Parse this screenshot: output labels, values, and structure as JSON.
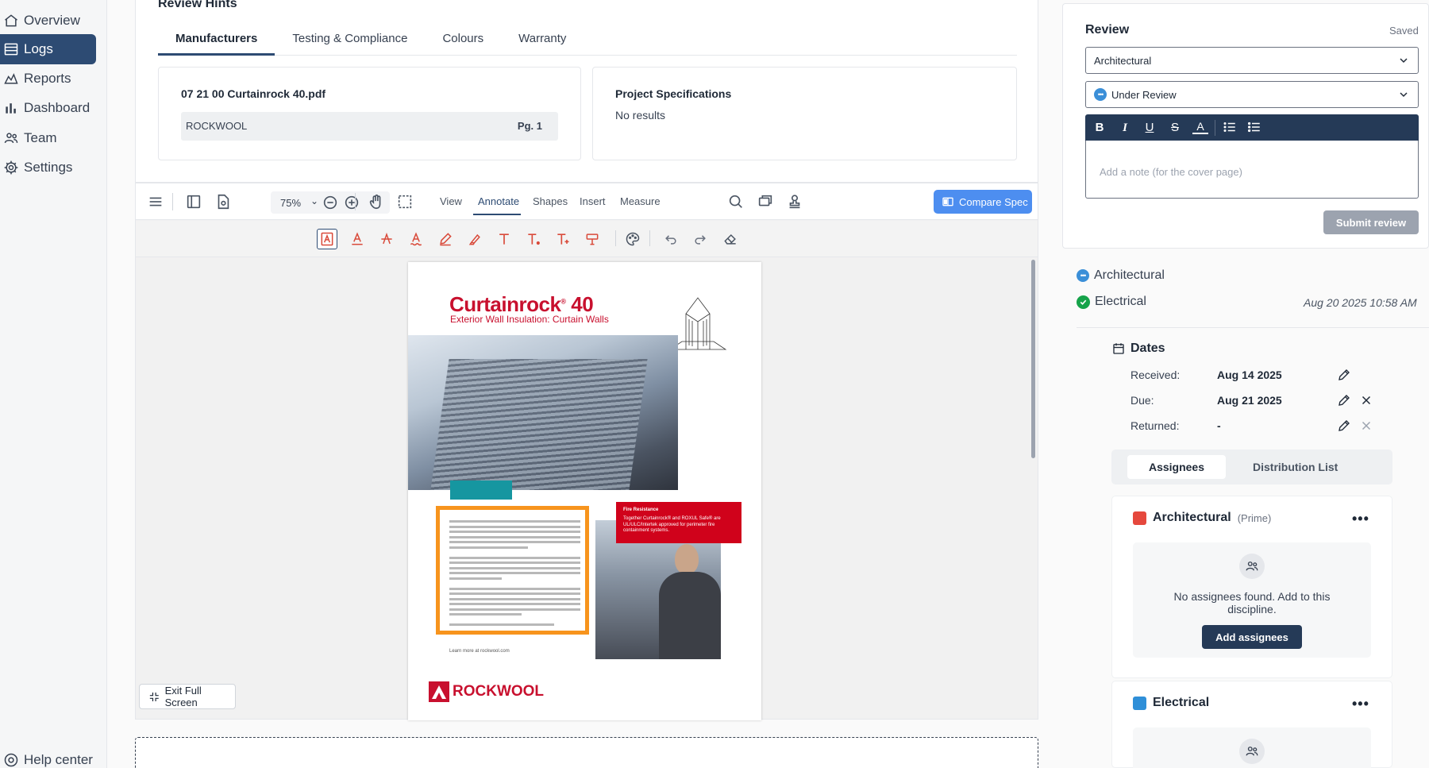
{
  "sidebar": {
    "items": [
      {
        "label": "Overview",
        "icon": "home-icon"
      },
      {
        "label": "Logs",
        "icon": "list-icon"
      },
      {
        "label": "Reports",
        "icon": "chart-area-icon"
      },
      {
        "label": "Dashboard",
        "icon": "bar-chart-icon"
      },
      {
        "label": "Team",
        "icon": "team-icon"
      },
      {
        "label": "Settings",
        "icon": "gear-icon"
      }
    ],
    "help": "Help center"
  },
  "hints": {
    "title": "Review Hints",
    "tabs": [
      "Manufacturers",
      "Testing & Compliance",
      "Colours",
      "Warranty"
    ],
    "file": {
      "name": "07 21 00 Curtainrock 40.pdf",
      "manufacturer": "ROCKWOOL",
      "page": "Pg. 1"
    },
    "specs": {
      "title": "Project Specifications",
      "result": "No results"
    }
  },
  "viewer": {
    "zoom": "75%",
    "tabs": [
      "View",
      "Annotate",
      "Shapes",
      "Insert",
      "Measure"
    ],
    "active_tab": "Annotate",
    "compare_label": "Compare Spec",
    "exit_label": "Exit Full Screen",
    "accent": "#4d8ef0"
  },
  "pdf": {
    "title": "Curtainrock",
    "reg": "®",
    "title_num": " 40",
    "subtitle": "Exterior Wall Insulation: Curtain Walls",
    "red_box_title": "Fire Resistance",
    "red_box_text": "Together Curtainrock® and ROXUL Safe® are UL/ULC/Intertek approved for perimeter fire containment systems.",
    "learn_more": "Learn more at rockwool.com",
    "logo": "ROCKWOOL"
  },
  "review": {
    "title": "Review",
    "saved": "Saved",
    "discipline": "Architectural",
    "status": "Under Review",
    "note_placeholder": "Add a note (for the cover page)",
    "submit": "Submit review",
    "editor_tools": [
      "B",
      "I",
      "U",
      "S",
      "A"
    ]
  },
  "disciplines": [
    {
      "name": "Architectural",
      "status": "in-review"
    },
    {
      "name": "Electrical",
      "status": "complete",
      "date": "Aug 20 2025 10:58 AM"
    }
  ],
  "dates": {
    "title": "Dates",
    "received_label": "Received:",
    "received": "Aug 14 2025",
    "due_label": "Due:",
    "due": "Aug 21 2025",
    "returned_label": "Returned:",
    "returned": "-"
  },
  "assignees": {
    "tabs": [
      "Assignees",
      "Distribution List"
    ],
    "cards": [
      {
        "name": "Architectural",
        "role": "(Prime)",
        "color": "#e5483d",
        "empty": "No assignees found. Add to this discipline.",
        "add": "Add assignees"
      },
      {
        "name": "Electrical",
        "role": "",
        "color": "#2f8fd8"
      }
    ]
  }
}
